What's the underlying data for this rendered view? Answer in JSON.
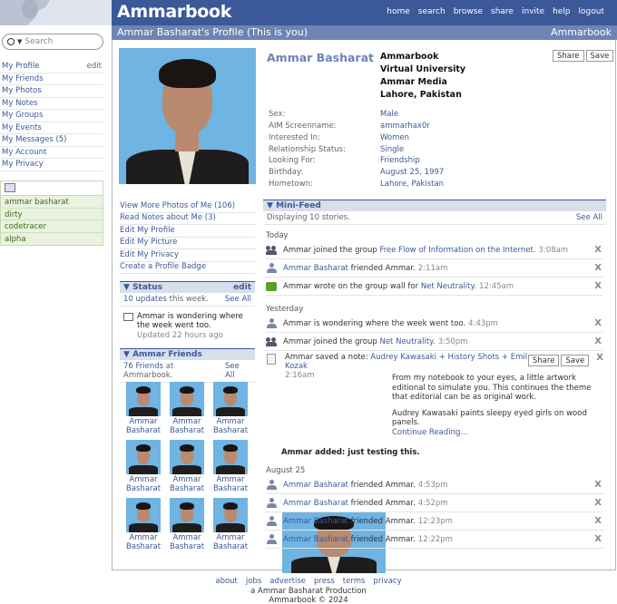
{
  "app": {
    "brand": "Ammarbook",
    "subtitle": "Ammarbook"
  },
  "topnav": [
    "home",
    "search",
    "browse",
    "share",
    "invite",
    "help",
    "logout"
  ],
  "search": {
    "placeholder": "Search"
  },
  "left_nav": {
    "edit_label": "edit",
    "items": [
      "My Profile",
      "My Friends",
      "My Photos",
      "My Notes",
      "My Groups",
      "My Events",
      "My Messages (5)",
      "My Account",
      "My Privacy"
    ]
  },
  "apps": [
    "ammar basharat",
    "dirty",
    "codetracer",
    "alpha"
  ],
  "profile": {
    "header_title": "Ammar Basharat's Profile (This is you)",
    "name": "Ammar Basharat",
    "networks": [
      "Ammarbook",
      "Virtual University",
      "Ammar Media",
      "Lahore, Pakistan"
    ],
    "share_label": "Share",
    "save_label": "Save",
    "info": [
      {
        "k": "Sex:",
        "v": "Male"
      },
      {
        "k": "AIM Screenname:",
        "v": "ammarhax0r"
      },
      {
        "k": "Interested In:",
        "v": "Women"
      },
      {
        "k": "Relationship Status:",
        "v": "Single"
      },
      {
        "k": "Looking For:",
        "v": "Friendship"
      },
      {
        "k": "Birthday:",
        "v": "August 25, 1997"
      },
      {
        "k": "Hometown:",
        "v": "Lahore, Pakistan"
      }
    ]
  },
  "profile_links": [
    "View More Photos of Me (106)",
    "Read Notes about Me (3)",
    "Edit My Profile",
    "Edit My Picture",
    "Edit My Privacy",
    "Create a Profile Badge"
  ],
  "status": {
    "title": "Status",
    "edit": "edit",
    "updates_count": "10 updates",
    "updates_suffix": "this week.",
    "see_all": "See All",
    "text": "Ammar is wondering where the week went too.",
    "updated": "Updated 22 hours ago"
  },
  "friends": {
    "title": "Ammar Friends",
    "count": "76 Friends",
    "count_suffix": "at Ammarbook.",
    "see_all": "See All",
    "items": [
      "Ammar Basharat",
      "Ammar Basharat",
      "Ammar Basharat",
      "Ammar Basharat",
      "Ammar Basharat",
      "Ammar Basharat",
      "Ammar Basharat",
      "Ammar Basharat",
      "Ammar Basharat"
    ]
  },
  "minifeed": {
    "title": "Mini-Feed",
    "displaying": "Displaying 10 stories.",
    "see_all": "See All",
    "days": [
      "Today",
      "Yesterday",
      "August 25"
    ],
    "today": [
      {
        "icon": "group-icon",
        "pre": "Ammar joined the group",
        "link": "Free Flow of Information on the Internet.",
        "time": "3:08am"
      },
      {
        "icon": "person-icon",
        "linkfirst": "Ammar Basharat",
        "post": "friended Ammar.",
        "time": "2:11am"
      },
      {
        "icon": "wall-post-icon",
        "pre": "Ammar wrote on the group wall for",
        "link": "Net Neutrality.",
        "time": "12:45am"
      }
    ],
    "yesterday": [
      {
        "icon": "status-icon",
        "pre": "Ammar is wondering where the week went too.",
        "time": "4:43pm"
      },
      {
        "icon": "group-icon",
        "pre": "Ammar joined the group",
        "link": "Net Neutrality.",
        "time": "3:50pm"
      }
    ],
    "note": {
      "pre": "Ammar saved a note:",
      "link": "Audrey Kawasaki + History Shots + Emil Kozak",
      "time": "2:16am",
      "share": "Share",
      "save": "Save",
      "body1": "From my notebook to your eyes, a little artwork editional to simulate you. This continues the theme that editorial can be as original work.",
      "body2": "Audrey Kawasaki paints sleepy eyed girls on wood panels.",
      "continue": "Continue Reading...",
      "added": "Ammar added: just testing this."
    },
    "aug25": [
      {
        "link": "Ammar Basharat",
        "post": "friended Ammar.",
        "time": "4:53pm"
      },
      {
        "link": "Ammar Basharat",
        "post": "friended Ammar.",
        "time": "4:52pm"
      },
      {
        "link": "Ammar Basharat",
        "post": "friended Ammar.",
        "time": "12:23pm"
      },
      {
        "link": "Ammar Basharat",
        "post": "friended Ammar.",
        "time": "12:22pm"
      }
    ],
    "close": "X"
  },
  "footer": {
    "links": [
      "about",
      "jobs",
      "advertise",
      "press",
      "terms",
      "privacy"
    ],
    "line1": "a Ammar Basharat Production",
    "line2": "Ammarbook © 2024"
  },
  "colors": {
    "brand_blue": "#3b5998",
    "sub_blue": "#6d84b4",
    "box_bg": "#d8dfea",
    "app_green": "#eaf3df"
  }
}
